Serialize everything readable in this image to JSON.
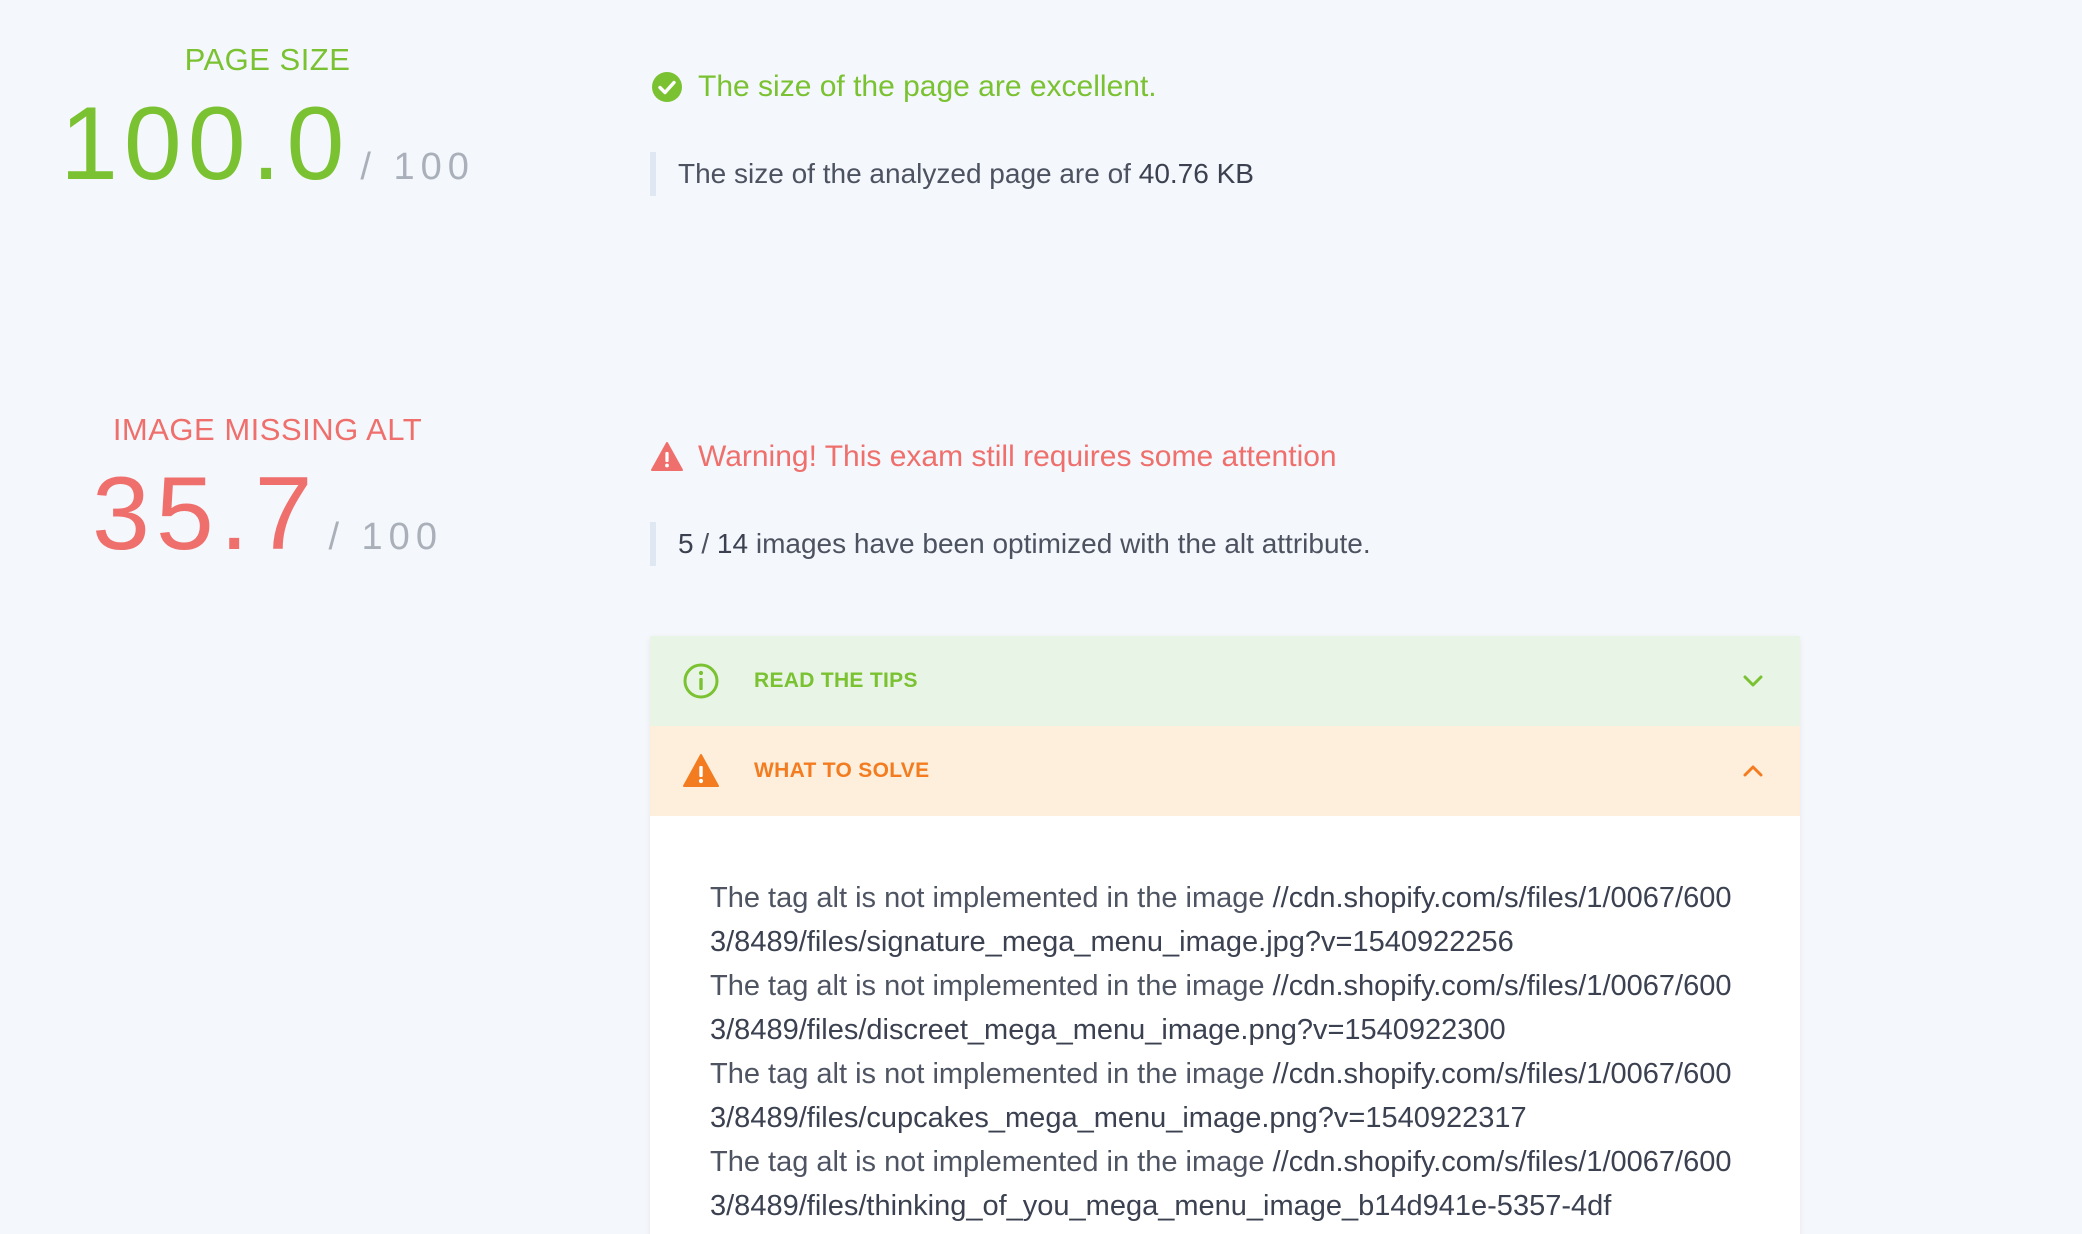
{
  "page_size": {
    "label": "PAGE SIZE",
    "score": "100.0",
    "outof": "/ 100",
    "status": "The size of the page are excellent.",
    "detail_prefix": "The size of the analyzed page are of ",
    "detail_value": "40.76 KB"
  },
  "image_alt": {
    "label": "IMAGE MISSING ALT",
    "score": "35.7",
    "outof": "/ 100",
    "status": "Warning! This exam still requires some attention",
    "detail_count": "5",
    "detail_sep": " / ",
    "detail_total": "14",
    "detail_suffix": " images have been optimized with the alt attribute."
  },
  "accordion": {
    "tips_label": "READ THE TIPS",
    "solve_label": "WHAT TO SOLVE",
    "issue_prefix": "The tag alt is not implemented in the image ",
    "issues": [
      "//cdn.shopify.com/s/files/1/0067/6003/8489/files/signature_mega_menu_image.jpg?v=1540922256",
      "//cdn.shopify.com/s/files/1/0067/6003/8489/files/discreet_mega_menu_image.png?v=1540922300",
      "//cdn.shopify.com/s/files/1/0067/6003/8489/files/cupcakes_mega_menu_image.png?v=1540922317",
      "//cdn.shopify.com/s/files/1/0067/6003/8489/files/thinking_of_you_mega_menu_image_b14d941e-5357-4df"
    ]
  },
  "colors": {
    "good": "#7ac231",
    "bad": "#ef6f6c",
    "warn": "#f37c20",
    "background": "#f4f7fb"
  },
  "icons": {
    "page_size_status": "check-circle-icon",
    "image_alt_status": "warning-triangle-icon",
    "tips": "info-circle-icon",
    "tips_toggle": "chevron-down-icon",
    "solve": "warning-triangle-icon",
    "solve_toggle": "chevron-up-icon"
  }
}
